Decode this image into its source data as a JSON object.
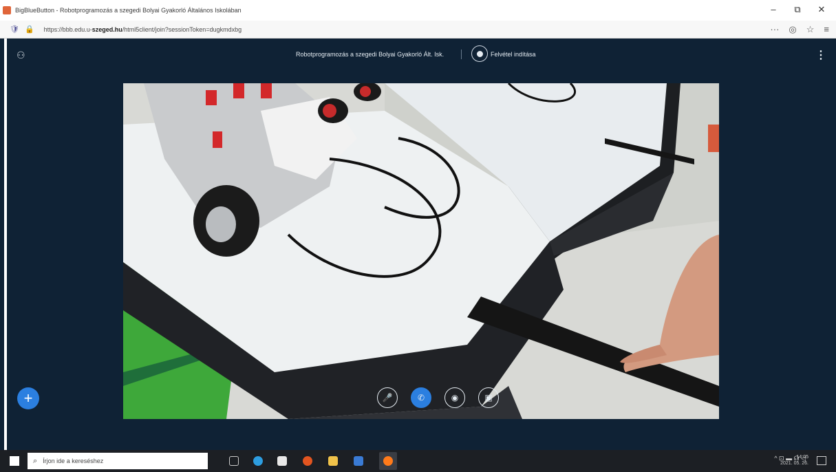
{
  "browser": {
    "tab_title": "BigBlueButton - Robotprogramozás a szegedi Bolyai Gyakorló Általános Iskolában",
    "url_prefix": "https://bbb.edu.u-",
    "url_bold": "szeged.hu",
    "url_rest": "/html5client/join?sessionToken=dugkmdxbg",
    "window_controls": {
      "minimize": "–",
      "restore": "⧉",
      "close": "✕"
    },
    "toolbar_icons": [
      "more-icon",
      "pocket-icon",
      "star-icon",
      "menu-icon"
    ]
  },
  "meeting": {
    "title": "Robotprogramozás a szegedi Bolyai Gyakorló Ált. Isk.",
    "record_label": "Felvétel indítása",
    "options_label": "⋮"
  },
  "controls": {
    "plus_label": "+",
    "mute_label": "🎤",
    "leave_label": "✆",
    "camera_label": "◉",
    "share_label": "▣"
  },
  "taskbar": {
    "search_placeholder": "Írjon ide a kereséshez",
    "tray_text": "^ ⊡ ▬ ☊ ◁",
    "time": "14:05",
    "date": "2021. 05. 26."
  },
  "colors": {
    "background": "#0f2235",
    "accent": "#2b7fe0",
    "taskbar": "#1c1f24"
  }
}
